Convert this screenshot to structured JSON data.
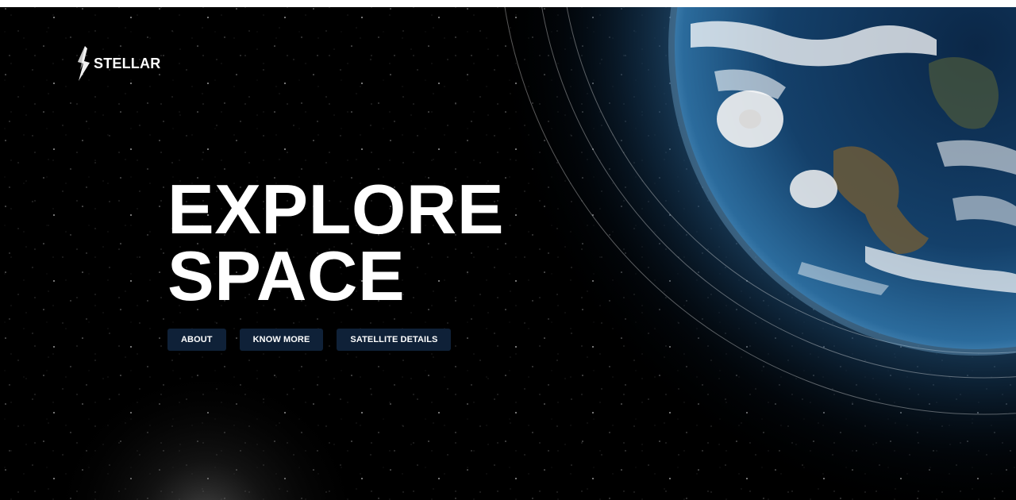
{
  "brand": {
    "name": "STELLAR",
    "icon": "lightning-bolt-icon"
  },
  "hero": {
    "title_line_1": "EXPLORE",
    "title_line_2": "SPACE"
  },
  "buttons": {
    "about": "ABOUT",
    "know_more": "KNOW MORE",
    "satellite_details": "SATELLITE DETAILS"
  },
  "colors": {
    "background": "#000000",
    "button_background": "#0f2138",
    "text": "#ffffff",
    "planet_ocean": "#2f6d9e"
  }
}
